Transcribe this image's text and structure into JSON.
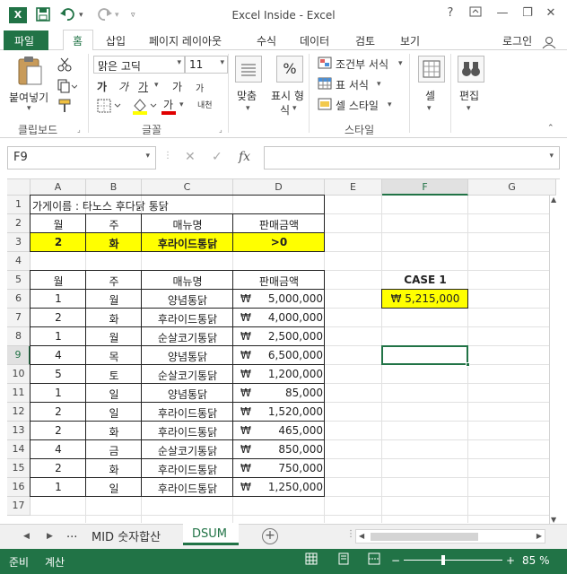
{
  "window": {
    "title": "Excel Inside - Excel",
    "help_label": "?",
    "minimize": "—",
    "restore": "❐",
    "close": "✕",
    "app_icon": "X",
    "save_icon": "floppy-icon",
    "undo_icon": "undo-icon",
    "redo_icon": "redo-icon"
  },
  "tabs": {
    "file": "파일",
    "home": "홈",
    "insert": "삽입",
    "page_layout": "페이지 레이아웃",
    "formulas": "수식",
    "data": "데이터",
    "review": "검토",
    "view": "보기",
    "login": "로그인"
  },
  "ribbon": {
    "paste": "붙여넣기",
    "font_name": "맑은 고딕",
    "font_size": "11",
    "bold": "가",
    "italic": "가",
    "underline": "가",
    "grow": "가",
    "shrink": "가",
    "font_color": "가",
    "phonetic": "내천",
    "align": "맞춤",
    "number_format_line1": "표시 형",
    "number_format_line2": "식",
    "percent": "%",
    "cond_format": "조건부 서식",
    "table_format": "표 서식",
    "cell_style": "셀 스타일",
    "cells": "셀",
    "edit": "편집",
    "group_clipboard": "클립보드",
    "group_font": "글꼴",
    "group_style": "스타일"
  },
  "formula_bar": {
    "name_box": "F9",
    "fx": "fx",
    "value": ""
  },
  "columns": [
    "A",
    "B",
    "C",
    "D",
    "E",
    "F",
    "G"
  ],
  "rows": [
    "1",
    "2",
    "3",
    "4",
    "5",
    "6",
    "7",
    "8",
    "9",
    "10",
    "11",
    "12",
    "13",
    "14",
    "15",
    "16",
    "17"
  ],
  "criteria": {
    "title": "가게이름 : 타노스 후다닭 통닭",
    "headers": [
      "월",
      "주",
      "매뉴명",
      "판매금액"
    ],
    "values": [
      "2",
      "화",
      "후라이드통닭",
      ">0"
    ]
  },
  "table": {
    "headers": [
      "월",
      "주",
      "매뉴명",
      "판매금액"
    ],
    "currency": "₩",
    "rows": [
      [
        "1",
        "월",
        "양념통닭",
        "5,000,000"
      ],
      [
        "2",
        "화",
        "후라이드통닭",
        "4,000,000"
      ],
      [
        "1",
        "월",
        "순살코기통닭",
        "2,500,000"
      ],
      [
        "4",
        "목",
        "양념통닭",
        "6,500,000"
      ],
      [
        "5",
        "토",
        "순살코기통닭",
        "1,200,000"
      ],
      [
        "1",
        "일",
        "양념통닭",
        "85,000"
      ],
      [
        "2",
        "일",
        "후라이드통닭",
        "1,520,000"
      ],
      [
        "2",
        "화",
        "후라이드통닭",
        "465,000"
      ],
      [
        "4",
        "금",
        "순살코기통닭",
        "850,000"
      ],
      [
        "2",
        "화",
        "후라이드통닭",
        "750,000"
      ],
      [
        "1",
        "일",
        "후라이드통닭",
        "1,250,000"
      ]
    ]
  },
  "case": {
    "label": "CASE 1",
    "result": "₩ 5,215,000"
  },
  "sheets": {
    "ellipsis": "...",
    "tab1": "MID 숫자합산",
    "tab2": "DSUM",
    "add": "+"
  },
  "status": {
    "ready": "준비",
    "calc": "계산",
    "zoom": "85 %"
  },
  "colors": {
    "excel_green": "#217346",
    "highlight": "#ffff00"
  }
}
